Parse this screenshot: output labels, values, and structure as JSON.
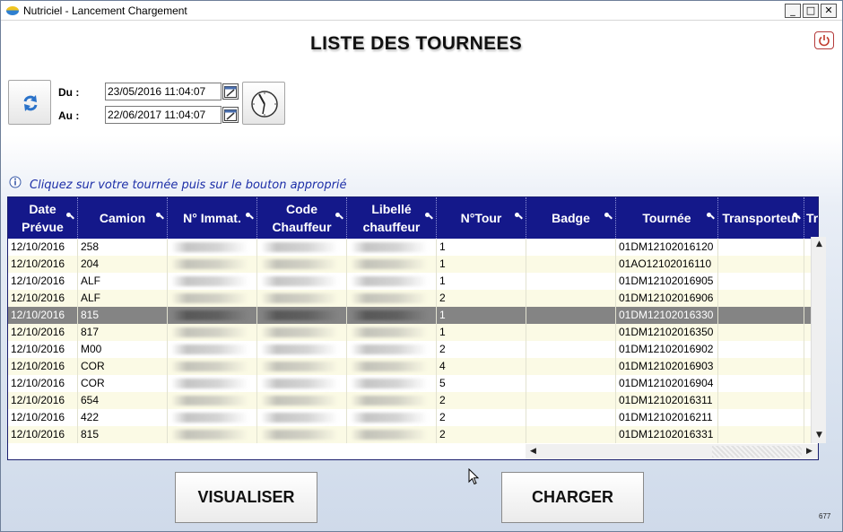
{
  "window": {
    "title": "Nutriciel - Lancement Chargement",
    "minimize_glyph": "_",
    "maximize_glyph": "□",
    "close_glyph": "✕"
  },
  "page_title": "LISTE DES TOURNEES",
  "filters": {
    "du_label": "Du :",
    "du_value": "23/05/2016 11:04:07",
    "au_label": "Au :",
    "au_value": "22/06/2017 11:04:07"
  },
  "instruction": "Cliquez sur votre tournée puis sur le bouton approprié",
  "grid": {
    "columns": [
      {
        "label": "Date\nPrévue"
      },
      {
        "label": "Camion"
      },
      {
        "label": "N° Immat."
      },
      {
        "label": "Code\nChauffeur"
      },
      {
        "label": "Libellé\nchauffeur"
      },
      {
        "label": "N°Tour"
      },
      {
        "label": "Badge"
      },
      {
        "label": "Tournée"
      },
      {
        "label": "Transporteur"
      },
      {
        "label": "Tr"
      }
    ],
    "rows": [
      {
        "date": "12/10/2016",
        "camion": "258",
        "tour": "1",
        "badge": "",
        "tournee": "01DM12102016120"
      },
      {
        "date": "12/10/2016",
        "camion": "204",
        "tour": "1",
        "badge": "",
        "tournee": "01AO12102016110"
      },
      {
        "date": "12/10/2016",
        "camion": "ALF",
        "tour": "1",
        "badge": "",
        "tournee": "01DM12102016905"
      },
      {
        "date": "12/10/2016",
        "camion": "ALF",
        "tour": "2",
        "badge": "",
        "tournee": "01DM12102016906"
      },
      {
        "date": "12/10/2016",
        "camion": "815",
        "tour": "1",
        "badge": "",
        "tournee": "01DM12102016330"
      },
      {
        "date": "12/10/2016",
        "camion": "817",
        "tour": "1",
        "badge": "",
        "tournee": "01DM12102016350"
      },
      {
        "date": "12/10/2016",
        "camion": "M00",
        "tour": "2",
        "badge": "",
        "tournee": "01DM12102016902"
      },
      {
        "date": "12/10/2016",
        "camion": "COR",
        "tour": "4",
        "badge": "",
        "tournee": "01DM12102016903"
      },
      {
        "date": "12/10/2016",
        "camion": "COR",
        "tour": "5",
        "badge": "",
        "tournee": "01DM12102016904"
      },
      {
        "date": "12/10/2016",
        "camion": "654",
        "tour": "2",
        "badge": "",
        "tournee": "01DM12102016311"
      },
      {
        "date": "12/10/2016",
        "camion": "422",
        "tour": "2",
        "badge": "",
        "tournee": "01DM12102016211"
      },
      {
        "date": "12/10/2016",
        "camion": "815",
        "tour": "2",
        "badge": "",
        "tournee": "01DM12102016331"
      }
    ],
    "selected_row": 5
  },
  "buttons": {
    "visualiser": "VISUALISER",
    "charger": "CHARGER"
  },
  "version": "677",
  "colors": {
    "header_bg": "#14188a",
    "row_even": "#fbfae5",
    "row_selected": "#848484",
    "instruction_text": "#1d2fa8"
  }
}
